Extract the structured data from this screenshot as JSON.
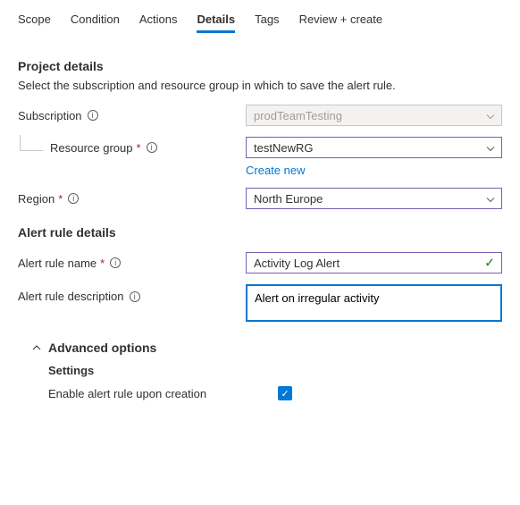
{
  "tabs": {
    "scope": "Scope",
    "condition": "Condition",
    "actions": "Actions",
    "details": "Details",
    "tags": "Tags",
    "review": "Review + create"
  },
  "project": {
    "title": "Project details",
    "helper": "Select the subscription and resource group in which to save the alert rule.",
    "subscription_label": "Subscription",
    "subscription_value": "prodTeamTesting",
    "resource_group_label": "Resource group",
    "resource_group_value": "testNewRG",
    "create_new": "Create new",
    "region_label": "Region",
    "region_value": "North Europe"
  },
  "alert": {
    "title": "Alert rule details",
    "name_label": "Alert rule name",
    "name_value": "Activity Log Alert",
    "desc_label": "Alert rule description",
    "desc_value": "Alert on irregular activity"
  },
  "advanced": {
    "title": "Advanced options",
    "settings": "Settings",
    "enable_label": "Enable alert rule upon creation"
  }
}
